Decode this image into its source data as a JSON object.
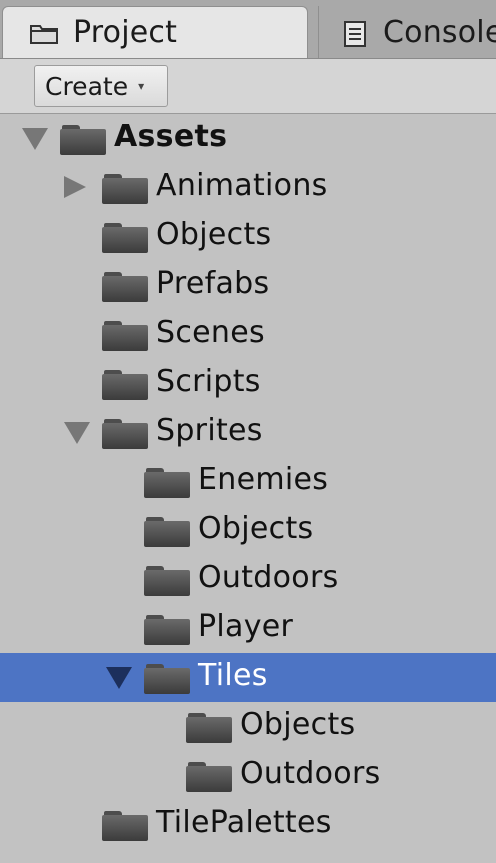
{
  "tabs": [
    {
      "label": "Project",
      "icon": "folder-tab-icon",
      "active": true
    },
    {
      "label": "Console",
      "icon": "console-icon",
      "active": false
    }
  ],
  "toolbar": {
    "create_label": "Create",
    "create_arrow": "▾"
  },
  "tree": [
    {
      "label": "Assets",
      "arrow": "down",
      "bold": true,
      "depth": 0,
      "selected": false
    },
    {
      "label": "Animations",
      "arrow": "right",
      "depth": 1,
      "selected": false
    },
    {
      "label": "Objects",
      "arrow": "none",
      "depth": 1,
      "selected": false
    },
    {
      "label": "Prefabs",
      "arrow": "none",
      "depth": 1,
      "selected": false
    },
    {
      "label": "Scenes",
      "arrow": "none",
      "depth": 1,
      "selected": false
    },
    {
      "label": "Scripts",
      "arrow": "none",
      "depth": 1,
      "selected": false
    },
    {
      "label": "Sprites",
      "arrow": "down",
      "depth": 1,
      "selected": false
    },
    {
      "label": "Enemies",
      "arrow": "none",
      "depth": 2,
      "selected": false
    },
    {
      "label": "Objects",
      "arrow": "none",
      "depth": 2,
      "selected": false
    },
    {
      "label": "Outdoors",
      "arrow": "none",
      "depth": 2,
      "selected": false
    },
    {
      "label": "Player",
      "arrow": "none",
      "depth": 2,
      "selected": false
    },
    {
      "label": "Tiles",
      "arrow": "down",
      "depth": 2,
      "selected": true
    },
    {
      "label": "Objects",
      "arrow": "none",
      "depth": 3,
      "selected": false
    },
    {
      "label": "Outdoors",
      "arrow": "none",
      "depth": 3,
      "selected": false
    },
    {
      "label": "TilePalettes",
      "arrow": "none",
      "depth": 1,
      "selected": false
    }
  ],
  "colors": {
    "selection": "#4d74c4",
    "panel": "#c2c2c2",
    "folder": "#4a4a4a"
  }
}
